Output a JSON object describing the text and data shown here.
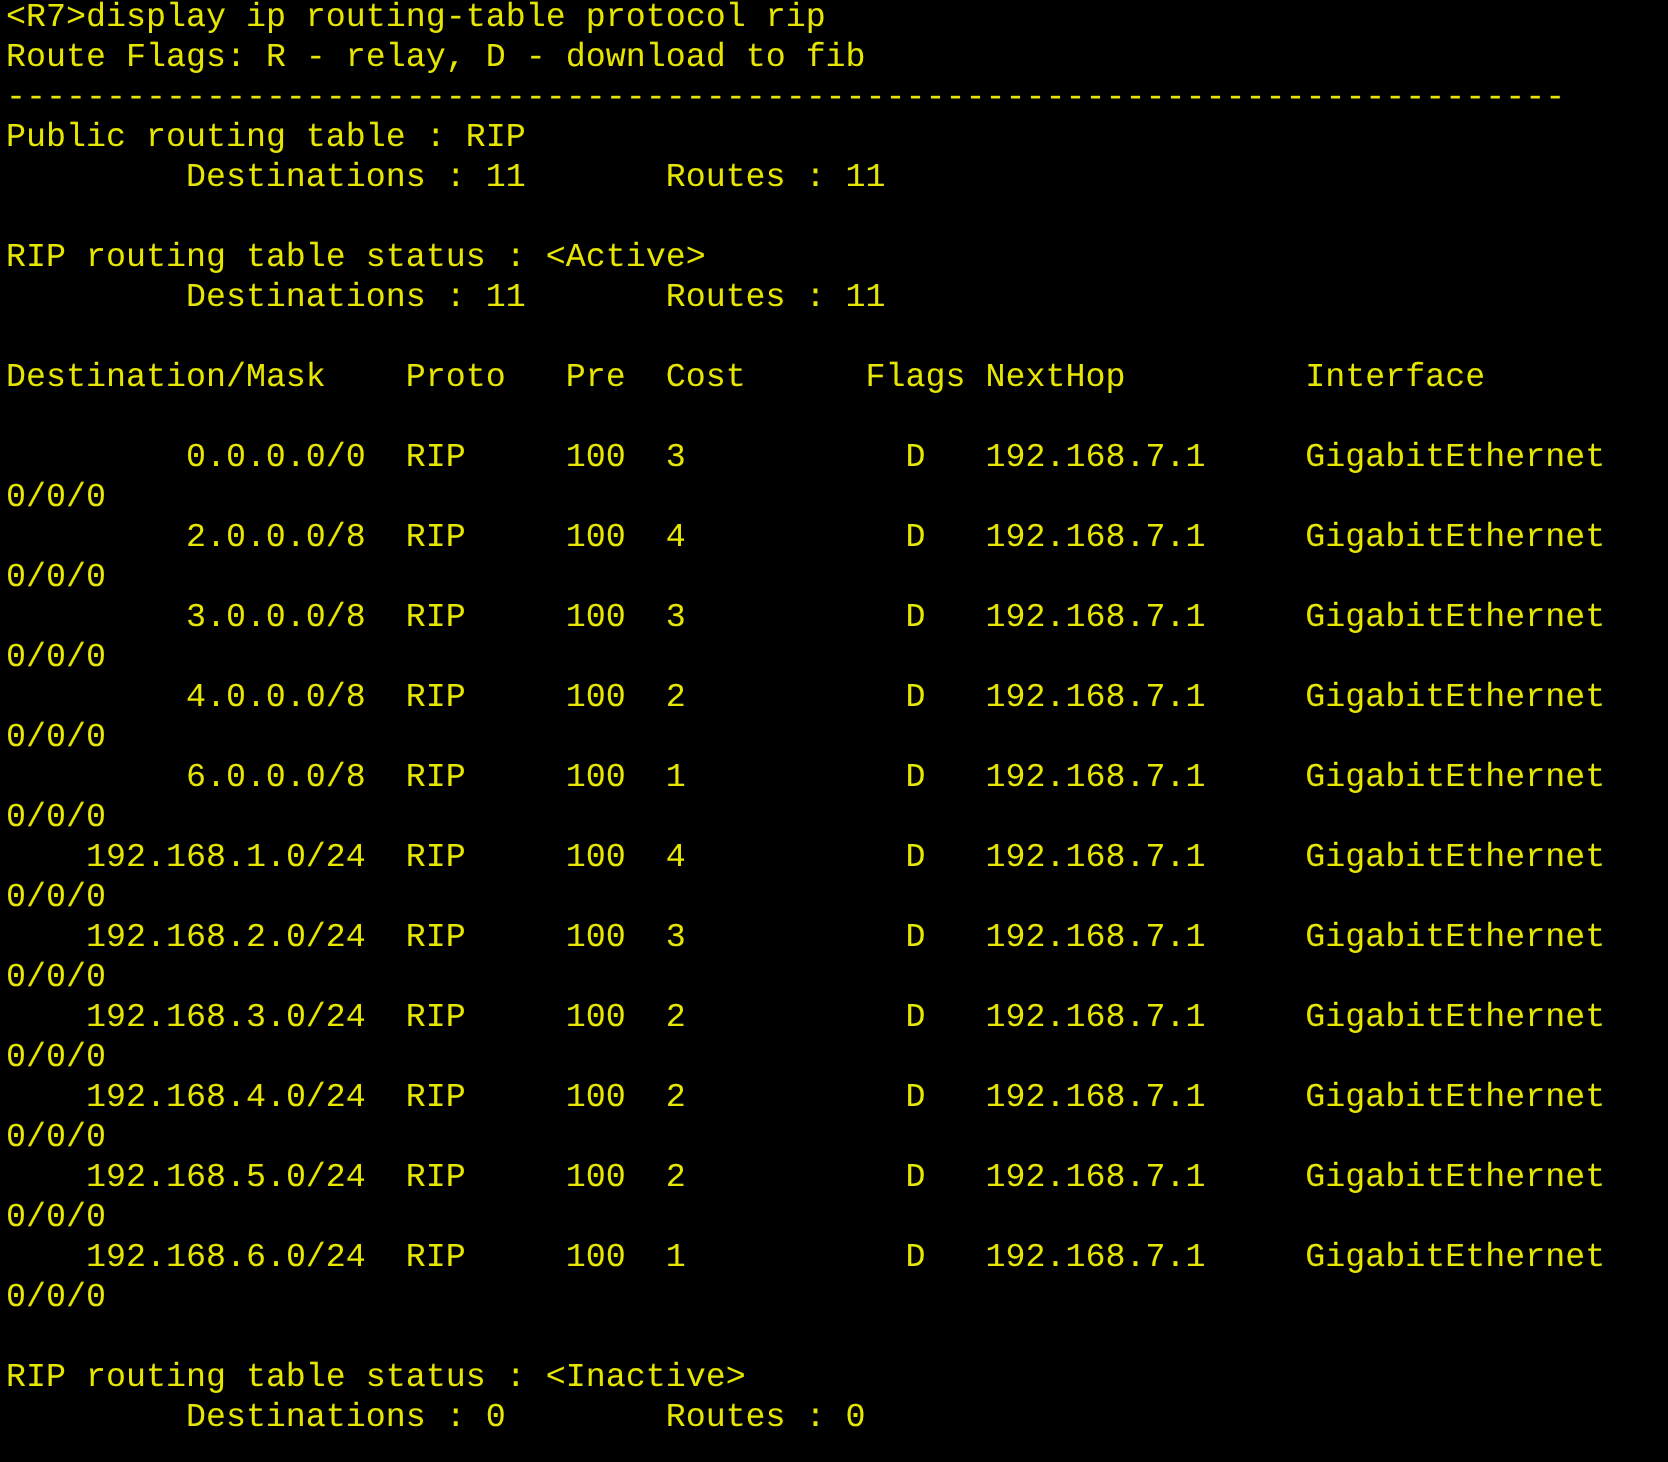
{
  "command": "<R7>display ip routing-table protocol rip",
  "legend": "Route Flags: R - relay, D - download to fib",
  "separator": "------------------------------------------------------------------------------",
  "public_table": {
    "title": "Public routing table : RIP",
    "destinations": "Destinations : 11",
    "routes": "Routes : 11"
  },
  "active_status": {
    "title": "RIP routing table status : <Active>",
    "destinations": "Destinations : 11",
    "routes": "Routes : 11"
  },
  "columns": [
    "Destination/Mask",
    "Proto",
    "Pre",
    "Cost",
    "Flags",
    "NextHop",
    "Interface"
  ],
  "rows": [
    {
      "destination": "0.0.0.0/0",
      "proto": "RIP",
      "pre": "100",
      "cost": "3",
      "flags": "D",
      "nexthop": "192.168.7.1",
      "interface": "GigabitEthernet",
      "interface_wrap": "0/0/0"
    },
    {
      "destination": "2.0.0.0/8",
      "proto": "RIP",
      "pre": "100",
      "cost": "4",
      "flags": "D",
      "nexthop": "192.168.7.1",
      "interface": "GigabitEthernet",
      "interface_wrap": "0/0/0"
    },
    {
      "destination": "3.0.0.0/8",
      "proto": "RIP",
      "pre": "100",
      "cost": "3",
      "flags": "D",
      "nexthop": "192.168.7.1",
      "interface": "GigabitEthernet",
      "interface_wrap": "0/0/0"
    },
    {
      "destination": "4.0.0.0/8",
      "proto": "RIP",
      "pre": "100",
      "cost": "2",
      "flags": "D",
      "nexthop": "192.168.7.1",
      "interface": "GigabitEthernet",
      "interface_wrap": "0/0/0"
    },
    {
      "destination": "6.0.0.0/8",
      "proto": "RIP",
      "pre": "100",
      "cost": "1",
      "flags": "D",
      "nexthop": "192.168.7.1",
      "interface": "GigabitEthernet",
      "interface_wrap": "0/0/0"
    },
    {
      "destination": "192.168.1.0/24",
      "proto": "RIP",
      "pre": "100",
      "cost": "4",
      "flags": "D",
      "nexthop": "192.168.7.1",
      "interface": "GigabitEthernet",
      "interface_wrap": "0/0/0"
    },
    {
      "destination": "192.168.2.0/24",
      "proto": "RIP",
      "pre": "100",
      "cost": "3",
      "flags": "D",
      "nexthop": "192.168.7.1",
      "interface": "GigabitEthernet",
      "interface_wrap": "0/0/0"
    },
    {
      "destination": "192.168.3.0/24",
      "proto": "RIP",
      "pre": "100",
      "cost": "2",
      "flags": "D",
      "nexthop": "192.168.7.1",
      "interface": "GigabitEthernet",
      "interface_wrap": "0/0/0"
    },
    {
      "destination": "192.168.4.0/24",
      "proto": "RIP",
      "pre": "100",
      "cost": "2",
      "flags": "D",
      "nexthop": "192.168.7.1",
      "interface": "GigabitEthernet",
      "interface_wrap": "0/0/0"
    },
    {
      "destination": "192.168.5.0/24",
      "proto": "RIP",
      "pre": "100",
      "cost": "2",
      "flags": "D",
      "nexthop": "192.168.7.1",
      "interface": "GigabitEthernet",
      "interface_wrap": "0/0/0"
    },
    {
      "destination": "192.168.6.0/24",
      "proto": "RIP",
      "pre": "100",
      "cost": "1",
      "flags": "D",
      "nexthop": "192.168.7.1",
      "interface": "GigabitEthernet",
      "interface_wrap": "0/0/0"
    }
  ],
  "inactive_status": {
    "title": "RIP routing table status : <Inactive>",
    "destinations": "Destinations : 0",
    "routes": "Routes : 0"
  }
}
